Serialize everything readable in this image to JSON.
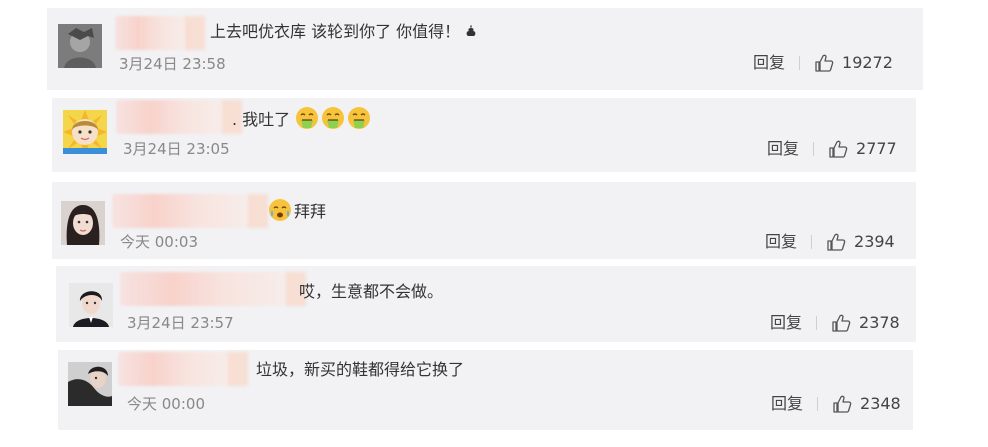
{
  "comments": [
    {
      "text": "上去吧优衣库 该轮到你了 你值得！",
      "time": "3月24日 23:58",
      "reply_label": "回复",
      "likes": "19272",
      "emoji": "poop-icon"
    },
    {
      "text": ". 我吐了",
      "time": "3月24日 23:05",
      "reply_label": "回复",
      "likes": "2777",
      "emoji": "vomit-face-icon"
    },
    {
      "text": "拜拜",
      "time": "今天 00:03",
      "reply_label": "回复",
      "likes": "2394",
      "emoji": "crying-face-icon"
    },
    {
      "text": "哎，生意都不会做。",
      "time": "3月24日 23:57",
      "reply_label": "回复",
      "likes": "2378"
    },
    {
      "text": "垃圾，新买的鞋都得给它换了",
      "time": "今天 00:00",
      "reply_label": "回复",
      "likes": "2348"
    }
  ],
  "colors": {
    "card_bg": "#f2f2f5",
    "text": "#333333",
    "time": "#888888",
    "action": "#444444",
    "name_blur": "#f8cec6"
  }
}
